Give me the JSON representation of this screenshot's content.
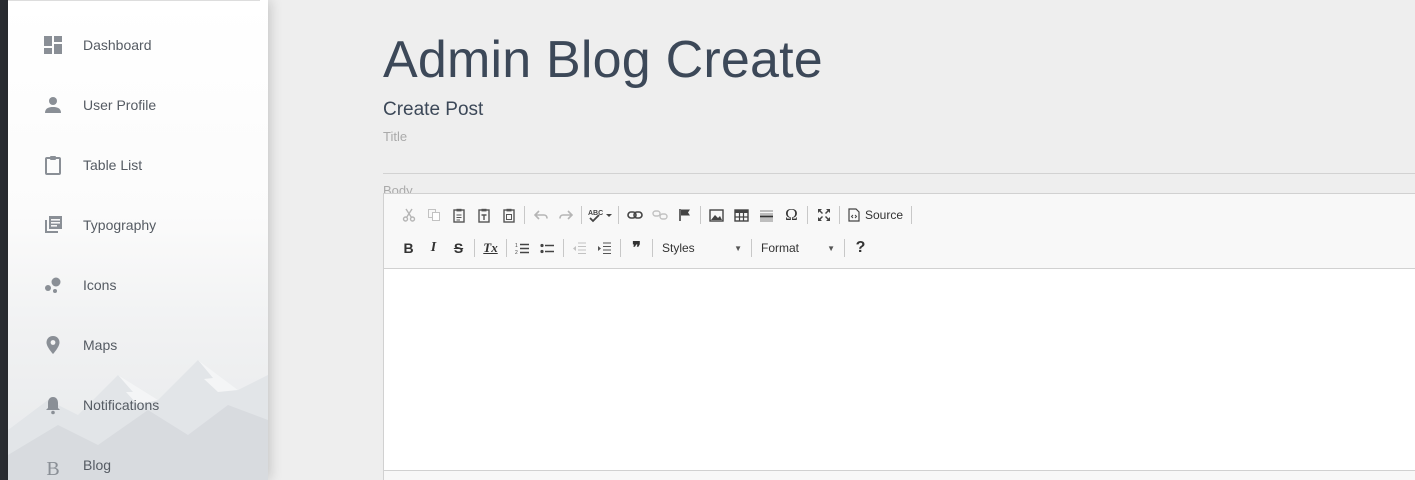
{
  "sidebar": {
    "items": [
      {
        "label": "Dashboard",
        "icon": "dashboard-icon"
      },
      {
        "label": "User Profile",
        "icon": "person-icon"
      },
      {
        "label": "Table List",
        "icon": "clipboard-icon"
      },
      {
        "label": "Typography",
        "icon": "library-books-icon"
      },
      {
        "label": "Icons",
        "icon": "bubble-chart-icon"
      },
      {
        "label": "Maps",
        "icon": "location-pin-icon"
      },
      {
        "label": "Notifications",
        "icon": "bell-icon"
      },
      {
        "label": "Blog",
        "icon": "blog-b-icon",
        "icon_text": "B"
      }
    ]
  },
  "main": {
    "page_title": "Admin Blog Create",
    "section_title": "Create Post",
    "title_label": "Title",
    "body_label": "Body"
  },
  "editor": {
    "source_label": "Source",
    "styles_label": "Styles",
    "format_label": "Format",
    "bold_glyph": "B",
    "italic_glyph": "I",
    "strike_glyph": "S",
    "remove_format_glyph": "Tx",
    "quote_glyph": "❞",
    "help_glyph": "?",
    "special_char_glyph": "Ω",
    "spellcheck_glyph": "ABC"
  },
  "colors": {
    "background": "#eeeeee",
    "heading": "#3c4858",
    "muted_label": "#aaaaaa",
    "sidebar_text": "#555b63",
    "dark_strip": "#2a2d32"
  }
}
